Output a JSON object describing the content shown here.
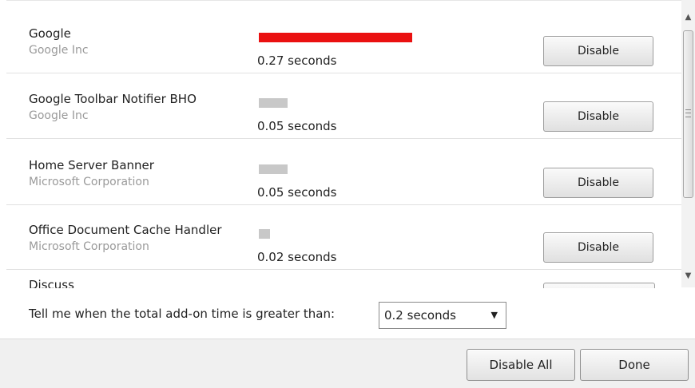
{
  "addons": [
    {
      "name": "Google",
      "publisher": "Google Inc",
      "load_time_text": "0.27  seconds",
      "load_time_seconds": 0.27,
      "exceeds_threshold": true,
      "bar_color": "#ea1111",
      "disable_label": "Disable"
    },
    {
      "name": "Google Toolbar Notifier BHO",
      "publisher": "Google Inc",
      "load_time_text": "0.05  seconds",
      "load_time_seconds": 0.05,
      "exceeds_threshold": false,
      "bar_color": "#c8c8c8",
      "disable_label": "Disable"
    },
    {
      "name": "Home Server Banner",
      "publisher": "Microsoft Corporation",
      "load_time_text": "0.05  seconds",
      "load_time_seconds": 0.05,
      "exceeds_threshold": false,
      "bar_color": "#c8c8c8",
      "disable_label": "Disable"
    },
    {
      "name": "Office Document Cache Handler",
      "publisher": "Microsoft Corporation",
      "load_time_text": "0.02  seconds",
      "load_time_seconds": 0.02,
      "exceeds_threshold": false,
      "bar_color": "#c8c8c8",
      "disable_label": "Disable"
    },
    {
      "name": "Discuss"
    }
  ],
  "threshold": {
    "label": "Tell me when the total add-on time is greater than:",
    "selected": "0.2 seconds"
  },
  "footer": {
    "disable_all_label": "Disable All",
    "done_label": "Done"
  },
  "icons": {
    "scroll_up": "triangle-up-icon",
    "scroll_down": "triangle-down-icon",
    "dropdown": "triangle-down-icon"
  }
}
